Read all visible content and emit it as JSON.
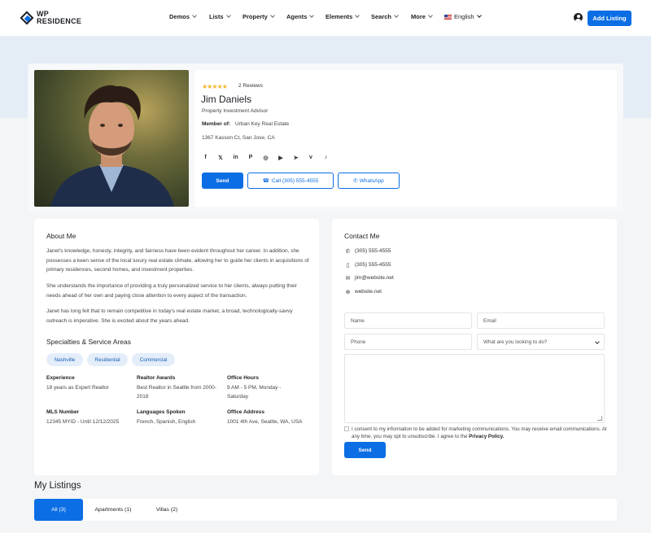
{
  "brand": {
    "line1": "WP",
    "line2": "RESIDENCE",
    "accent": "#0b6ee4"
  },
  "nav": {
    "items": [
      "Demos",
      "Lists",
      "Property",
      "Agents",
      "Elements",
      "Search",
      "More"
    ],
    "language": "English",
    "add_listing": "Add Listing"
  },
  "agent": {
    "rating_stars": "★★★★★",
    "reviews": "2 Reviews",
    "name": "Jim Daniels",
    "role": "Property Investment Advisor",
    "member_label": "Member of:",
    "member_value": "Urban Key Real Estate",
    "address": "1367 Kasson Ct, San Jose, CA",
    "social": [
      "facebook-icon",
      "x-icon",
      "linkedin-icon",
      "pinterest-icon",
      "instagram-icon",
      "youtube-icon",
      "telegram-icon",
      "vimeo-icon",
      "tiktok-icon"
    ],
    "buttons": {
      "send": "Send",
      "call": "Call (305) 555-4555",
      "whatsapp": "WhatsApp"
    }
  },
  "about": {
    "title": "About Me",
    "paragraphs": [
      "Janet's knowledge, honesty, integrity, and fairness have been evident throughout her career. In addition, she possesses a keen sense of the local luxury real estate climate, allowing her to guide her clients in acquisitions of primary residences, second homes, and investment properties.",
      "She understands the importance of providing a truly personalized service to her clients, always putting their needs ahead of her own and paying close attention to every aspect of the transaction.",
      "Janet has long felt that to remain competitive in today's real estate market, a broad, technologically-savvy outreach is imperative. She is excited about the years ahead."
    ],
    "specialties_title": "Specialties & Service Areas",
    "chips": [
      "Nashville",
      "Residential",
      "Commercial"
    ],
    "details": [
      {
        "label": "Experience",
        "value": "18 years as Expert Realtor"
      },
      {
        "label": "Realtor Awards",
        "value": "Best Realtor in Seattle from 2000-2018"
      },
      {
        "label": "Office Hours",
        "value": "9 AM - 5 PM, Monday - Saturday"
      },
      {
        "label": "MLS Number",
        "value": "12345 MYID - Until 12/12/2025"
      },
      {
        "label": "Languages Spoken",
        "value": "French, Spanish, English"
      },
      {
        "label": "Office Address",
        "value": "1001 4th Ave, Seattle, WA, USA"
      }
    ]
  },
  "contact": {
    "title": "Contact Me",
    "phone1": "(305) 555-4555",
    "phone2": "(305) 555-4555",
    "email": "jim@website.net",
    "website": "website.net",
    "form": {
      "name_placeholder": "Name",
      "email_placeholder": "Email",
      "phone_placeholder": "Phone",
      "select_value": "What are you looking to do?",
      "consent_text": "I consent to my information to be added for marketing communications. You may receive email communications. At any time, you may opt to unsubscribe. I agree to the",
      "consent_link": "Privacy Policy.",
      "send": "Send"
    }
  },
  "listings": {
    "title": "My Listings",
    "tabs": [
      "All (3)",
      "Apartments (1)",
      "Villas (2)"
    ]
  }
}
